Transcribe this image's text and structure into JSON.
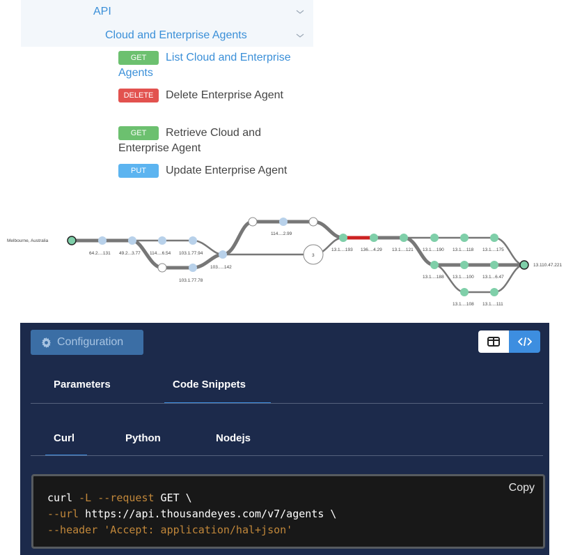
{
  "nav": {
    "api_label": "API",
    "agents_label": "Cloud and Enterprise Agents",
    "endpoints": [
      {
        "method": "GET",
        "title": "List Cloud and Enterprise Agents"
      },
      {
        "method": "DELETE",
        "title": "Delete Enterprise Agent"
      },
      {
        "method": "GET",
        "title": "Retrieve Cloud and Enterprise Agent"
      },
      {
        "method": "PUT",
        "title": "Update Enterprise Agent"
      }
    ]
  },
  "path_viz": {
    "source": "Melbourne, Australia",
    "destination": "13.110.47.221",
    "hop_labels": [
      "64.2....131",
      "49.2...3.77",
      "114....6.54",
      "103.1.77.94",
      "103.1.77.78",
      "103.....142",
      "114....2.99",
      "13.1....193",
      "136....4.29",
      "13.1....121",
      "13.1....190",
      "13.1....118",
      "13.1....175",
      "13.1....188",
      "13.1....100",
      "13.1...6.47",
      "13.1....108",
      "13.1....111"
    ],
    "collapsed_count": "3",
    "colors": {
      "hop": "#b8d1ea",
      "hop_green": "#7fcfa9",
      "link": "#777777",
      "link_red": "#cc2222"
    }
  },
  "panel": {
    "config_label": "Configuration",
    "main_tabs": [
      "Parameters",
      "Code Snippets"
    ],
    "lang_tabs": [
      "Curl",
      "Python",
      "Nodejs"
    ],
    "copy_label": "Copy",
    "code": {
      "l1_cmd": "curl",
      "l1_flags": " -L --request",
      "l1_rest": " GET \\",
      "l2_flag": "--url",
      "l2_rest": " https://api.thousandeyes.com/v7/agents \\",
      "l3_flag": "--header",
      "l3_str": " 'Accept: application/hal+json'"
    },
    "colors": {
      "bg": "#1c2a4b",
      "accent": "#3d8ee0"
    }
  }
}
